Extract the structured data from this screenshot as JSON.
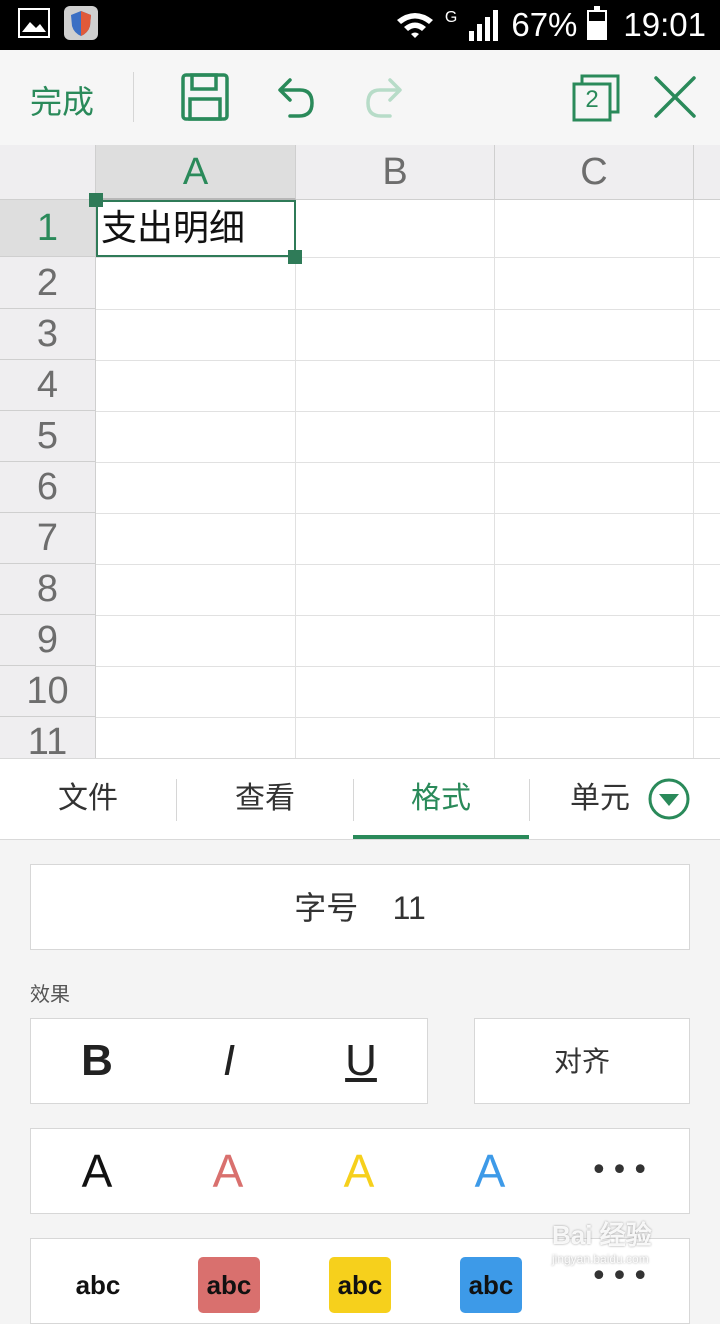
{
  "status_bar": {
    "battery_text": "67%",
    "time": "19:01",
    "network": "G",
    "icons": [
      "gallery-icon",
      "shield-icon",
      "wifi-icon",
      "signal-icon",
      "battery-icon"
    ]
  },
  "toolbar": {
    "done_label": "完成",
    "tab_count": "2",
    "icons": [
      "save-icon",
      "undo-icon",
      "redo-icon",
      "tabs-icon",
      "close-icon"
    ]
  },
  "sheet": {
    "columns": [
      "A",
      "B",
      "C"
    ],
    "rows": [
      "1",
      "2",
      "3",
      "4",
      "5",
      "6",
      "7",
      "8",
      "9",
      "10",
      "11"
    ],
    "selected_cell": {
      "column": "A",
      "row": "1",
      "value": "支出明细"
    }
  },
  "tabs": [
    {
      "label": "文件"
    },
    {
      "label": "查看"
    },
    {
      "label": "格式",
      "active": true
    },
    {
      "label": "单元"
    }
  ],
  "format_panel": {
    "font_size_label": "字号",
    "font_size_value": "11",
    "effects_label": "效果",
    "bold": "B",
    "italic": "I",
    "underline": "U",
    "align_label": "对齐",
    "font_colors": [
      {
        "glyph": "A",
        "color": "#111111"
      },
      {
        "glyph": "A",
        "color": "#d9706e"
      },
      {
        "glyph": "A",
        "color": "#f6d01c"
      },
      {
        "glyph": "A",
        "color": "#3d9ae8"
      }
    ],
    "more": "•••",
    "highlights": [
      {
        "text": "abc",
        "color": "#ffffff"
      },
      {
        "text": "abc",
        "color": "#d9706e"
      },
      {
        "text": "abc",
        "color": "#f6d01c"
      },
      {
        "text": "abc",
        "color": "#3d9ae8"
      }
    ]
  },
  "watermark": {
    "brand": "Bai 经验",
    "url": "jingyan.baidu.com"
  },
  "colors": {
    "accent": "#2a8a5a",
    "selection": "#2f7b58"
  }
}
